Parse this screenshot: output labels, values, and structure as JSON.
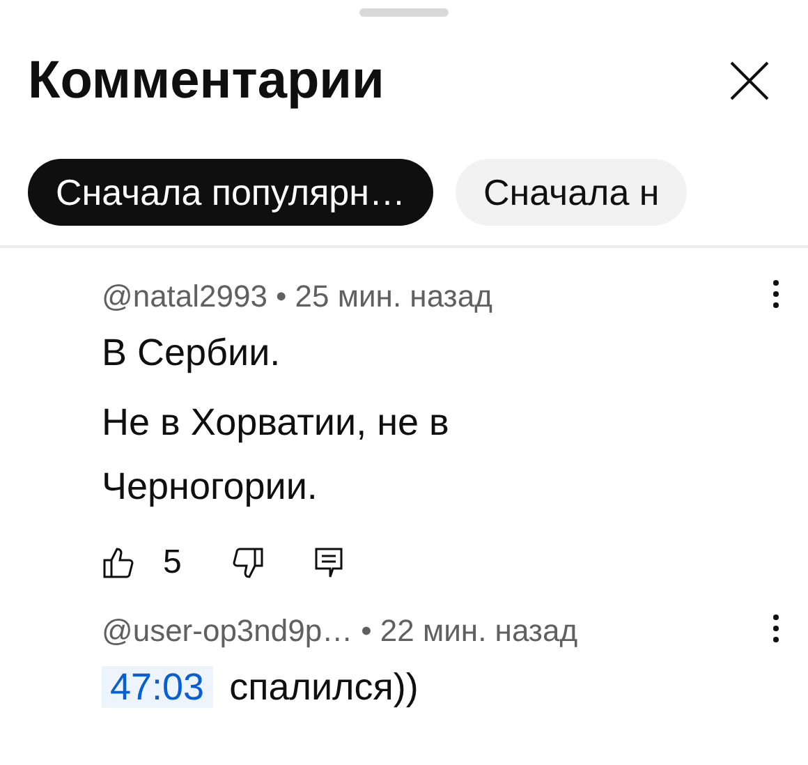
{
  "title": "Комментарии",
  "chips": [
    {
      "label": "Сначала популярн…",
      "selected": true
    },
    {
      "label": "Сначала н",
      "selected": false
    }
  ],
  "comments": [
    {
      "author": "@natal2993",
      "time": "• 25 мин. назад",
      "paragraphs": [
        [
          {
            "kind": "text",
            "text": "В Сербии."
          }
        ],
        [
          {
            "kind": "text",
            "text": "Не в Хорватии, не в Черногории."
          }
        ]
      ],
      "likes": "5"
    },
    {
      "author": "@user-op3nd9p…",
      "time": "• 22 мин. назад",
      "paragraphs": [
        [
          {
            "kind": "timestamp",
            "text": "47:03"
          },
          {
            "kind": "text",
            "text": "спалился))"
          }
        ]
      ]
    }
  ]
}
